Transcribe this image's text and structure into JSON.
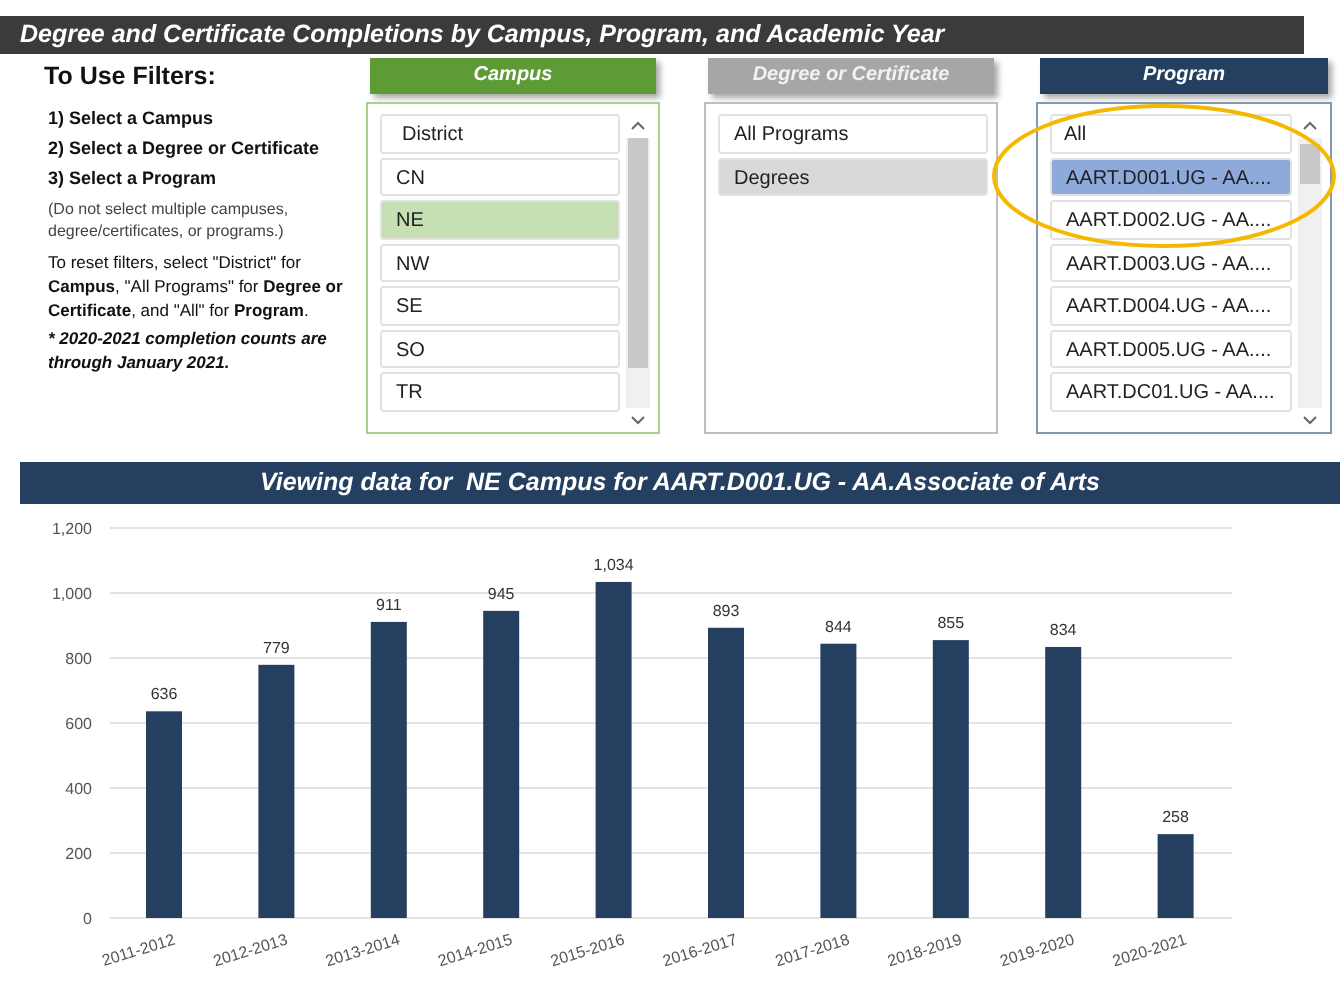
{
  "title": "Degree and Certificate Completions by Campus, Program, and Academic Year",
  "instructions": {
    "heading": "To Use Filters:",
    "steps": [
      "1) Select a Campus",
      "2) Select a Degree or Certificate",
      "3) Select a Program"
    ],
    "note": "(Do not select multiple campuses, degree/certificates, or programs.)",
    "reset": "To reset filters, select \"District\" for **Campus**, \"All Programs\" for **Degree or Certificate**, and \"All\" for **Program**.",
    "footnote": "* 2020-2021 completion counts are through January 2021."
  },
  "slicers": [
    {
      "title": "Campus",
      "kind": "campus",
      "scrollbar": true,
      "items": [
        {
          "label": "District",
          "selected": false
        },
        {
          "label": "CN",
          "selected": false
        },
        {
          "label": "NE",
          "selected": true
        },
        {
          "label": "NW",
          "selected": false
        },
        {
          "label": "SE",
          "selected": false
        },
        {
          "label": "SO",
          "selected": false
        },
        {
          "label": "TR",
          "selected": false
        }
      ]
    },
    {
      "title": "Degree or Certificate",
      "kind": "degree",
      "scrollbar": false,
      "items": [
        {
          "label": "All Programs",
          "selected": false
        },
        {
          "label": "Degrees",
          "selected": true
        }
      ]
    },
    {
      "title": "Program",
      "kind": "program",
      "scrollbar": true,
      "items": [
        {
          "label": "All",
          "selected": false
        },
        {
          "label": "AART.D001.UG - AA....",
          "selected": true
        },
        {
          "label": "AART.D002.UG - AA....",
          "selected": false
        },
        {
          "label": "AART.D003.UG - AA....",
          "selected": false
        },
        {
          "label": "AART.D004.UG - AA....",
          "selected": false
        },
        {
          "label": "AART.D005.UG - AA....",
          "selected": false
        },
        {
          "label": "AART.DC01.UG - AA....",
          "selected": false
        }
      ]
    }
  ],
  "chart": {
    "banner": "Viewing data for  NE Campus for AART.D001.UG - AA.Associate of Arts",
    "chart_data": {
      "type": "bar",
      "categories": [
        "2011-2012",
        "2012-2013",
        "2013-2014",
        "2014-2015",
        "2015-2016",
        "2016-2017",
        "2017-2018",
        "2018-2019",
        "2019-2020",
        "2020-2021"
      ],
      "grid": true,
      "series": [
        {
          "color": "#243f60",
          "values": [
            636,
            779,
            911,
            945,
            1034,
            893,
            844,
            855,
            834,
            258
          ]
        }
      ],
      "value_labels": [
        "636",
        "779",
        "911",
        "945",
        "1,034",
        "893",
        "844",
        "855",
        "834",
        "258"
      ],
      "ylim": [
        0,
        1200
      ],
      "yticks": [
        {
          "value": 0,
          "label": "0"
        },
        {
          "value": 200,
          "label": "200"
        },
        {
          "value": 400,
          "label": "400"
        },
        {
          "value": 600,
          "label": "600"
        },
        {
          "value": 800,
          "label": "800"
        },
        {
          "value": 1000,
          "label": "1,000"
        },
        {
          "value": 1200,
          "label": "1,200"
        }
      ]
    }
  }
}
